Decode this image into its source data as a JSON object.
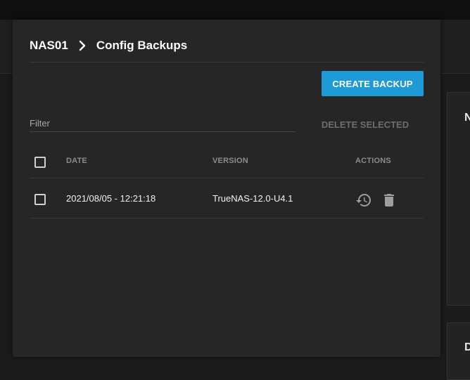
{
  "breadcrumb": {
    "parent": "NAS01",
    "current": "Config Backups"
  },
  "toolbar": {
    "create_label": "CREATE BACKUP",
    "delete_label": "DELETE SELECTED"
  },
  "filter": {
    "placeholder": "Filter",
    "value": ""
  },
  "table": {
    "columns": [
      "DATE",
      "VERSION",
      "ACTIONS"
    ],
    "rows": [
      {
        "date": "2021/08/05 - 12:21:18",
        "version": "TrueNAS-12.0-U4.1",
        "actions": [
          "restore-icon",
          "delete-icon"
        ]
      }
    ]
  },
  "background": {
    "card_one_letter": "N",
    "card_two_letter": "D"
  },
  "colors": {
    "accent": "#1e9ad6",
    "panel": "#262626",
    "disabled_text": "#6e6e6e"
  }
}
